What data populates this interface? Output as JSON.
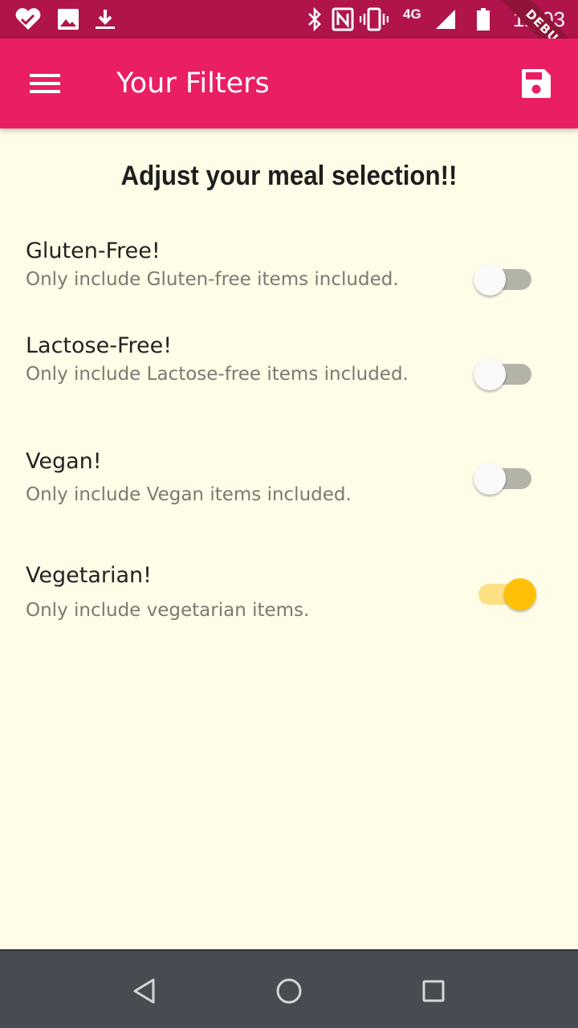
{
  "status_bar": {
    "time": "12:03",
    "network": "4G",
    "debug_label": "DEBUG",
    "icons": [
      "health-icon",
      "image-icon",
      "download-icon",
      "bluetooth-icon",
      "nfc-icon",
      "vibrate-icon",
      "signal-icon",
      "battery-icon"
    ]
  },
  "app_bar": {
    "title": "Your Filters",
    "menu_icon": "menu-icon",
    "save_icon": "save-icon"
  },
  "main": {
    "heading": "Adjust your meal selection!!",
    "filters": [
      {
        "title": "Gluten-Free!",
        "subtitle": "Only include Gluten-free items included.",
        "enabled": false
      },
      {
        "title": "Lactose-Free!",
        "subtitle": "Only include Lactose-free items included.",
        "enabled": false
      },
      {
        "title": "Vegan!",
        "subtitle": "Only include Vegan items included.",
        "enabled": false
      },
      {
        "title": "Vegetarian!",
        "subtitle": "Only include vegetarian items.",
        "enabled": true
      }
    ]
  },
  "nav_bar": {
    "icons": [
      "back-icon",
      "home-icon",
      "recents-icon"
    ]
  },
  "colors": {
    "status_bar": "#b0144a",
    "app_bar": "#e91e63",
    "background": "#fffde7",
    "switch_on": "#ffc107",
    "nav_bar": "#474c52"
  }
}
